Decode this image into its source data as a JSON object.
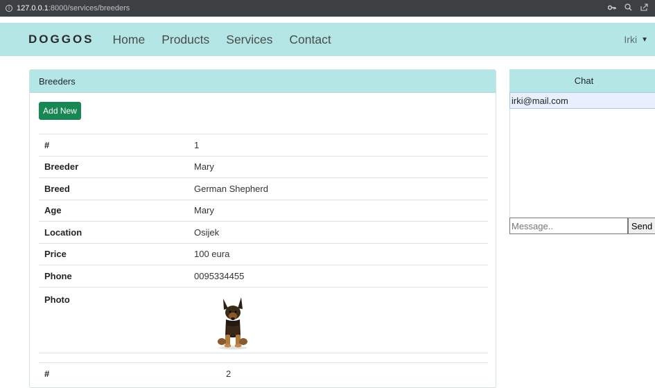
{
  "browser": {
    "url_host": "127.0.0.1",
    "url_path": ":8000/services/breeders",
    "tool_icons": [
      "key-icon",
      "zoom-icon",
      "share-icon"
    ]
  },
  "navbar": {
    "brand": "DOGGOS",
    "links": [
      "Home",
      "Products",
      "Services",
      "Contact"
    ],
    "user": "Irki"
  },
  "card": {
    "title": "Breeders",
    "add_button": "Add New",
    "rows": [
      {
        "key": "#",
        "value": "1"
      },
      {
        "key": "Breeder",
        "value": "Mary"
      },
      {
        "key": "Breed",
        "value": "German Shepherd"
      },
      {
        "key": "Age",
        "value": "Mary"
      },
      {
        "key": "Location",
        "value": "Osijek"
      },
      {
        "key": "Price",
        "value": "100 eura"
      },
      {
        "key": "Phone",
        "value": "0095334455"
      },
      {
        "key": "Photo",
        "value": ""
      }
    ],
    "second_row": {
      "key": "#",
      "value": "2"
    }
  },
  "chat": {
    "title": "Chat",
    "users": [
      "irki@mail.com"
    ],
    "message_placeholder": "Message..",
    "send_label": "Send"
  },
  "colors": {
    "accent": "#b4e6e6",
    "button": "#198754"
  }
}
